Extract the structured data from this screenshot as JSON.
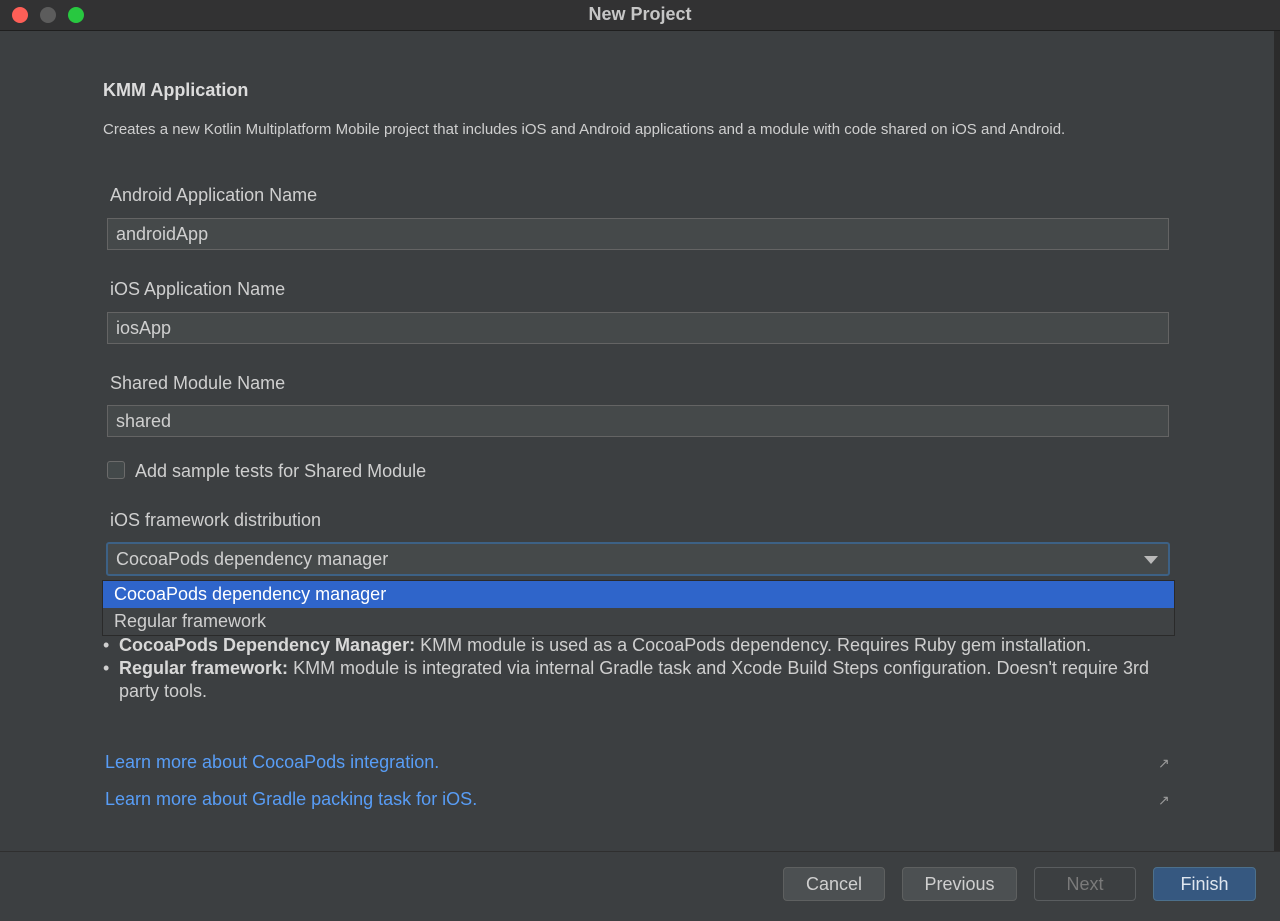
{
  "window": {
    "title": "New Project"
  },
  "page": {
    "heading": "KMM Application",
    "description": "Creates a new Kotlin Multiplatform Mobile project that includes iOS and Android applications and a module with code shared on iOS and Android."
  },
  "fields": {
    "android": {
      "label": "Android Application Name",
      "value": "androidApp"
    },
    "ios": {
      "label": "iOS Application Name",
      "value": "iosApp"
    },
    "shared": {
      "label": "Shared Module Name",
      "value": "shared"
    }
  },
  "checkbox": {
    "label": "Add sample tests for Shared Module",
    "checked": false
  },
  "distribution": {
    "label": "iOS framework distribution",
    "selected": "CocoaPods dependency manager",
    "options": [
      "CocoaPods dependency manager",
      "Regular framework"
    ]
  },
  "bullets": [
    {
      "bullet": "•",
      "term": "CocoaPods Dependency Manager:",
      "text": " KMM module is used as a CocoaPods dependency. Requires Ruby gem installation."
    },
    {
      "bullet": "•",
      "term": "Regular framework:",
      "text": " KMM module is integrated via internal Gradle task and Xcode Build Steps configuration. Doesn't require 3rd party tools."
    }
  ],
  "links": [
    {
      "text": "Learn more about CocoaPods integration.",
      "icon": "↗"
    },
    {
      "text": "Learn more about Gradle packing task for iOS.",
      "icon": "↗"
    }
  ],
  "buttons": {
    "cancel": "Cancel",
    "previous": "Previous",
    "next": "Next",
    "finish": "Finish"
  },
  "colors": {
    "accent": "#2f65ca",
    "link": "#589df6",
    "background": "#3c3f41"
  }
}
